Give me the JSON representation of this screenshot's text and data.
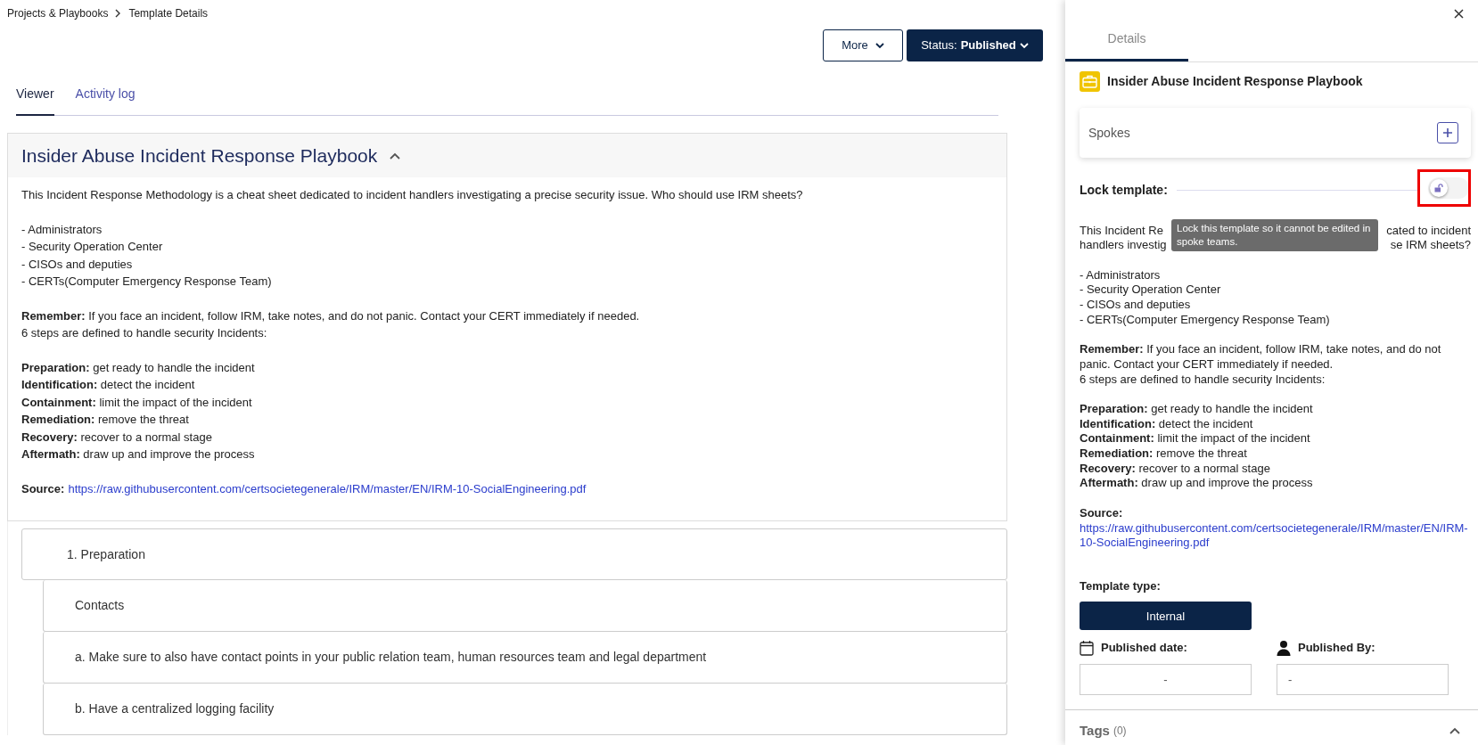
{
  "breadcrumb": [
    "Projects & Playbooks",
    "Template Details"
  ],
  "actions": {
    "more": "More",
    "status_label": "Status:",
    "status_value": "Published"
  },
  "tabs": [
    {
      "label": "Viewer",
      "selected": true
    },
    {
      "label": "Activity log",
      "selected": false
    }
  ],
  "playbook": {
    "title": "Insider Abuse Incident Response Playbook",
    "expanded": true,
    "description": [
      [
        "This Incident Response Methodology is a cheat sheet dedicated to incident handlers investigating a precise security issue. Who should use IRM sheets?"
      ],
      [
        "- Administrators",
        "- Security Operation Center",
        "- CISOs and deputies",
        "- CERTs(Computer Emergency Response Team)"
      ],
      [
        "**Remember:** If you face an incident, follow IRM, take notes, and do not panic. Contact your CERT immediately if needed.",
        "6 steps are defined to handle security Incidents:"
      ],
      [
        "**Preparation:** get ready to handle the incident",
        "**Identification:** detect the incident",
        "**Containment:** limit the impact of the incident",
        "**Remediation:** remove the threat",
        "**Recovery:** recover to a normal stage",
        "**Aftermath:** draw up and improve the process"
      ]
    ],
    "source": {
      "label": "Source:",
      "url": "https://raw.githubusercontent.com/certsocietegenerale/IRM/master/EN/IRM-10-SocialEngineering.pdf"
    }
  },
  "steps": [
    {
      "text": "1. Preparation",
      "children": [
        {
          "text": "Contacts"
        },
        {
          "text": "a. Make sure to also have contact points in your public relation team, human resources team and legal department"
        },
        {
          "text": "b. Have a centralized logging facility"
        }
      ]
    }
  ],
  "panel": {
    "tabs": [
      {
        "label": "Details",
        "selected": true
      }
    ],
    "title": "Insider Abuse Incident Response Playbook",
    "spokes": {
      "label": "Spokes"
    },
    "lock": {
      "label": "Lock template:",
      "on": false,
      "tooltip": "Lock this template so it cannot be edited in spoke teams."
    },
    "intro": [
      [
        "This Incident Re",
        "cated to incident"
      ],
      [
        "handlers investig",
        "se IRM sheets?"
      ]
    ],
    "description": [
      [
        "- Administrators",
        "- Security Operation Center",
        "- CISOs and deputies",
        "- CERTs(Computer Emergency Response Team)"
      ],
      [
        "**Remember:** If you face an incident, follow IRM, take notes, and do not panic. Contact your CERT immediately if needed.",
        "6 steps are defined to handle security Incidents:"
      ],
      [
        "**Preparation:** get ready to handle the incident",
        "**Identification:** detect the incident",
        "**Containment:** limit the impact of the incident",
        "**Remediation:** remove the threat",
        "**Recovery:** recover to a normal stage",
        "**Aftermath:** draw up and improve the process"
      ]
    ],
    "source": {
      "label": "Source:",
      "url": "https://raw.githubusercontent.com/certsocietegenerale/IRM/master/EN/IRM-10-SocialEngineering.pdf"
    },
    "template_type": {
      "label": "Template type:",
      "value": "Internal"
    },
    "published_date": {
      "label": "Published date:",
      "value": "-"
    },
    "published_by": {
      "label": "Published By:",
      "value": "-"
    },
    "tags": {
      "label": "Tags",
      "count": "(0)",
      "expanded": true
    }
  }
}
